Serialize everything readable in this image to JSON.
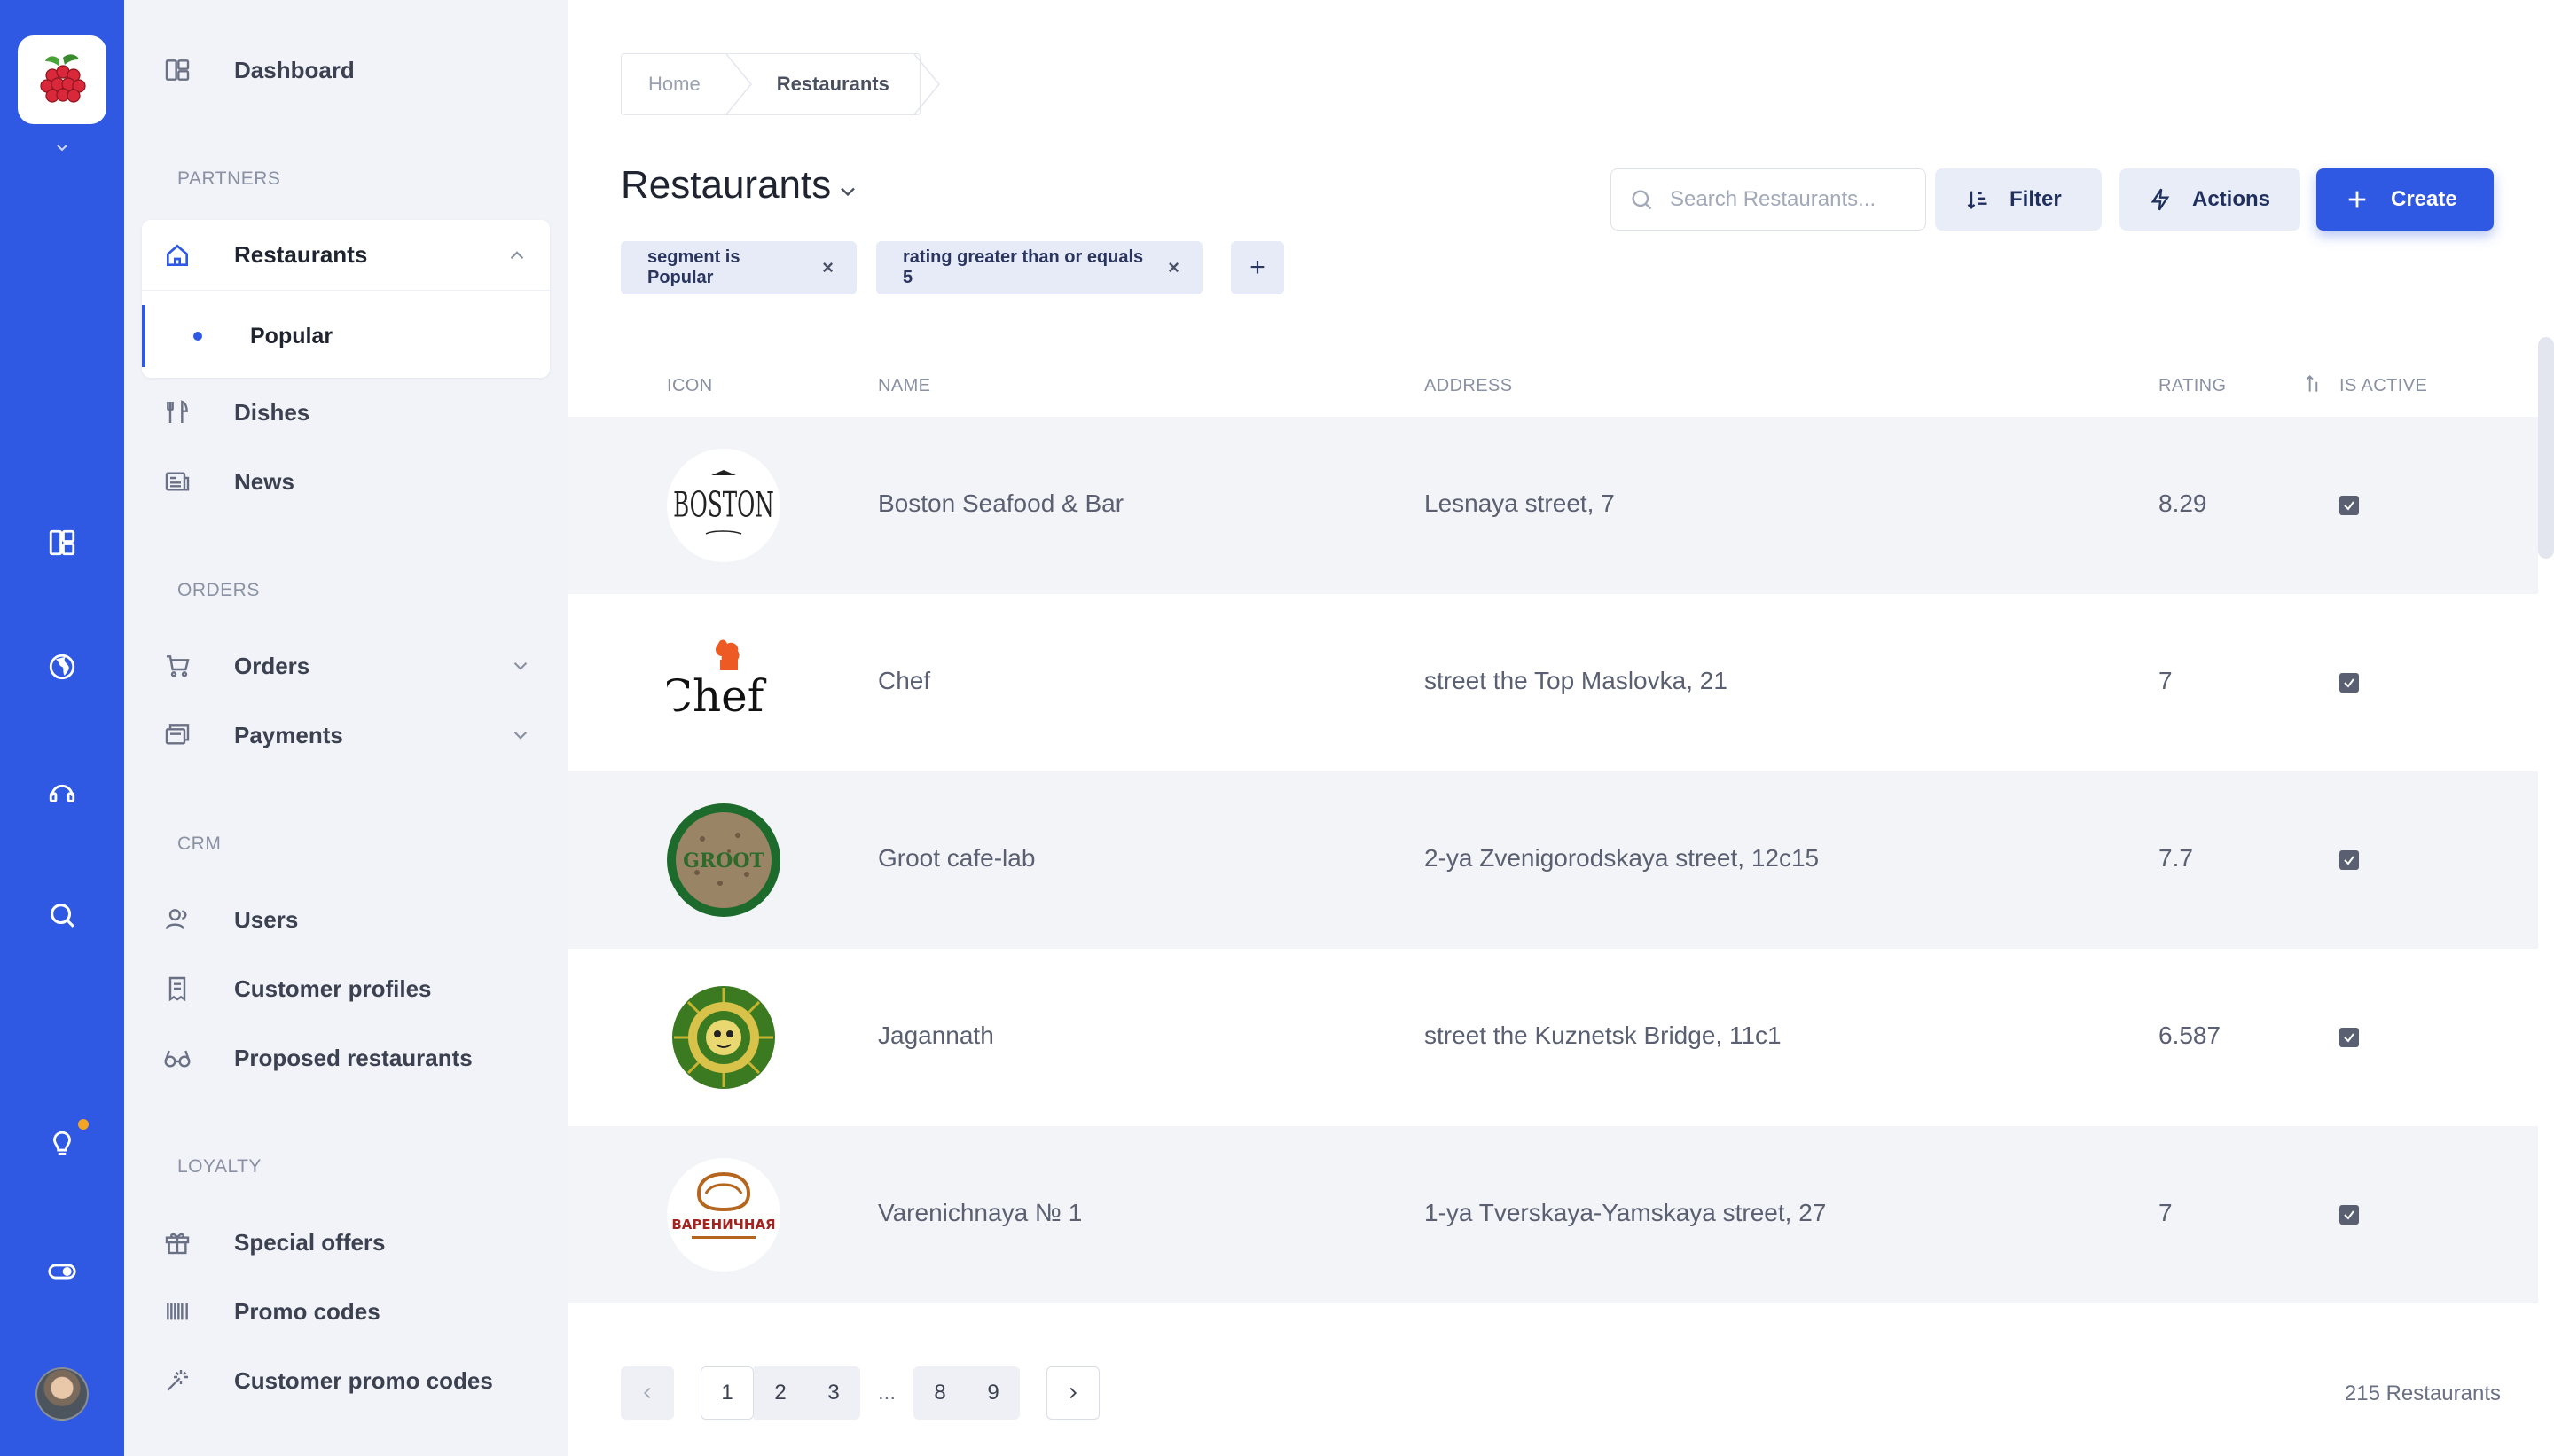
{
  "rail": {
    "icons": [
      "raspberry-logo",
      "chevron-down-icon",
      "dashboard-icon",
      "globe-icon",
      "support-icon",
      "search-icon",
      "lightbulb-icon",
      "toggle-icon",
      "avatar"
    ]
  },
  "sidebar": {
    "dashboard": "Dashboard",
    "sections": {
      "partners": "PARTNERS",
      "orders": "ORDERS",
      "crm": "CRM",
      "loyalty": "LOYALTY"
    },
    "restaurants": "Restaurants",
    "popular": "Popular",
    "dishes": "Dishes",
    "news": "News",
    "orders": "Orders",
    "payments": "Payments",
    "users": "Users",
    "customer_profiles": "Customer profiles",
    "proposed_restaurants": "Proposed restaurants",
    "special_offers": "Special offers",
    "promo_codes": "Promo codes",
    "customer_promo_codes": "Customer promo codes"
  },
  "breadcrumb": {
    "home": "Home",
    "current": "Restaurants"
  },
  "page": {
    "title": "Restaurants",
    "search_placeholder": "Search Restaurants...",
    "filter": "Filter",
    "actions": "Actions",
    "create": "Create"
  },
  "chips": [
    "segment is Popular",
    "rating greater than or equals 5"
  ],
  "chip_close": "×",
  "chip_add": "+",
  "table": {
    "headers": {
      "icon": "ICON",
      "name": "NAME",
      "address": "ADDRESS",
      "rating": "RATING",
      "is_active": "IS ACTIVE"
    },
    "rows": [
      {
        "name": "Boston Seafood & Bar",
        "address": "Lesnaya street, 7",
        "rating": "8.29",
        "active": true,
        "logo": "boston-logo"
      },
      {
        "name": "Chef",
        "address": "street the Top Maslovka, 21",
        "rating": "7",
        "active": true,
        "logo": "chef-logo"
      },
      {
        "name": "Groot cafe-lab",
        "address": "2-ya Zvenigorodskaya street, 12c15",
        "rating": "7.7",
        "active": true,
        "logo": "groot-logo"
      },
      {
        "name": "Jagannath",
        "address": "street the Kuznetsk Bridge, 11c1",
        "rating": "6.587",
        "active": true,
        "logo": "jagannath-logo"
      },
      {
        "name": "Varenichnaya № 1",
        "address": "1-ya Tverskaya-Yamskaya street, 27",
        "rating": "7",
        "active": true,
        "logo": "varenichnaya-logo"
      }
    ],
    "logo_text": {
      "boston": "BOSTON",
      "chef": "Chef",
      "groot": "GROOT",
      "varenichnaya": "ВАРЕНИЧНАЯ"
    }
  },
  "pagination": {
    "pages": [
      "1",
      "2",
      "3",
      "...",
      "8",
      "9"
    ],
    "current": "1",
    "total": "215 Restaurants"
  },
  "colors": {
    "primary": "#2f59e3",
    "sidebar_bg": "#f1f3f8",
    "notification": "#f5a524"
  }
}
